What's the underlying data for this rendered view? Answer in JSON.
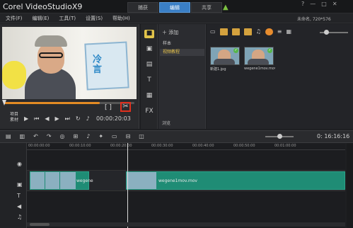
{
  "app": {
    "brand": "Corel VideoStudioX9"
  },
  "tabs": [
    {
      "label": "捕获"
    },
    {
      "label": "编辑"
    },
    {
      "label": "共享"
    }
  ],
  "window_controls": {
    "help": "?",
    "minimize": "—",
    "maximize": "□",
    "close": "✕"
  },
  "menu": [
    {
      "label": "文件(F)"
    },
    {
      "label": "编辑(E)"
    },
    {
      "label": "工具(T)"
    },
    {
      "label": "设置(S)"
    },
    {
      "label": "帮助(H)"
    }
  ],
  "project_info": "未命名, 720*576",
  "preview": {
    "sign_text": "冷\n言",
    "mode_label": "项目\n素材",
    "timecode": "00:00:20:03",
    "cut_label": "✂",
    "markers_label": "[ ]",
    "progress": 0.74
  },
  "library": {
    "add_label": "添加",
    "folders": [
      {
        "label": "样本"
      },
      {
        "label": "视频教程"
      }
    ],
    "media": [
      {
        "label": "新建1.jpg"
      },
      {
        "label": "wegene1mov.mov"
      }
    ],
    "browse_label": "浏览"
  },
  "timeline": {
    "timecode": "0: 16:16:16",
    "ruler": [
      "00:00:00:00",
      "00:00:10:00",
      "00:00:20:00",
      "00:00:30:00",
      "00:00:40:00",
      "00:00:50:00",
      "00:01:00:00"
    ],
    "clips": [
      {
        "label": "wegene"
      },
      {
        "label": "wegene1mov.mov"
      }
    ]
  },
  "colors": {
    "accent": "#3a7fc6",
    "clip": "#1f8c75",
    "highlight": "#e0301e",
    "progress": "#e38b24"
  }
}
